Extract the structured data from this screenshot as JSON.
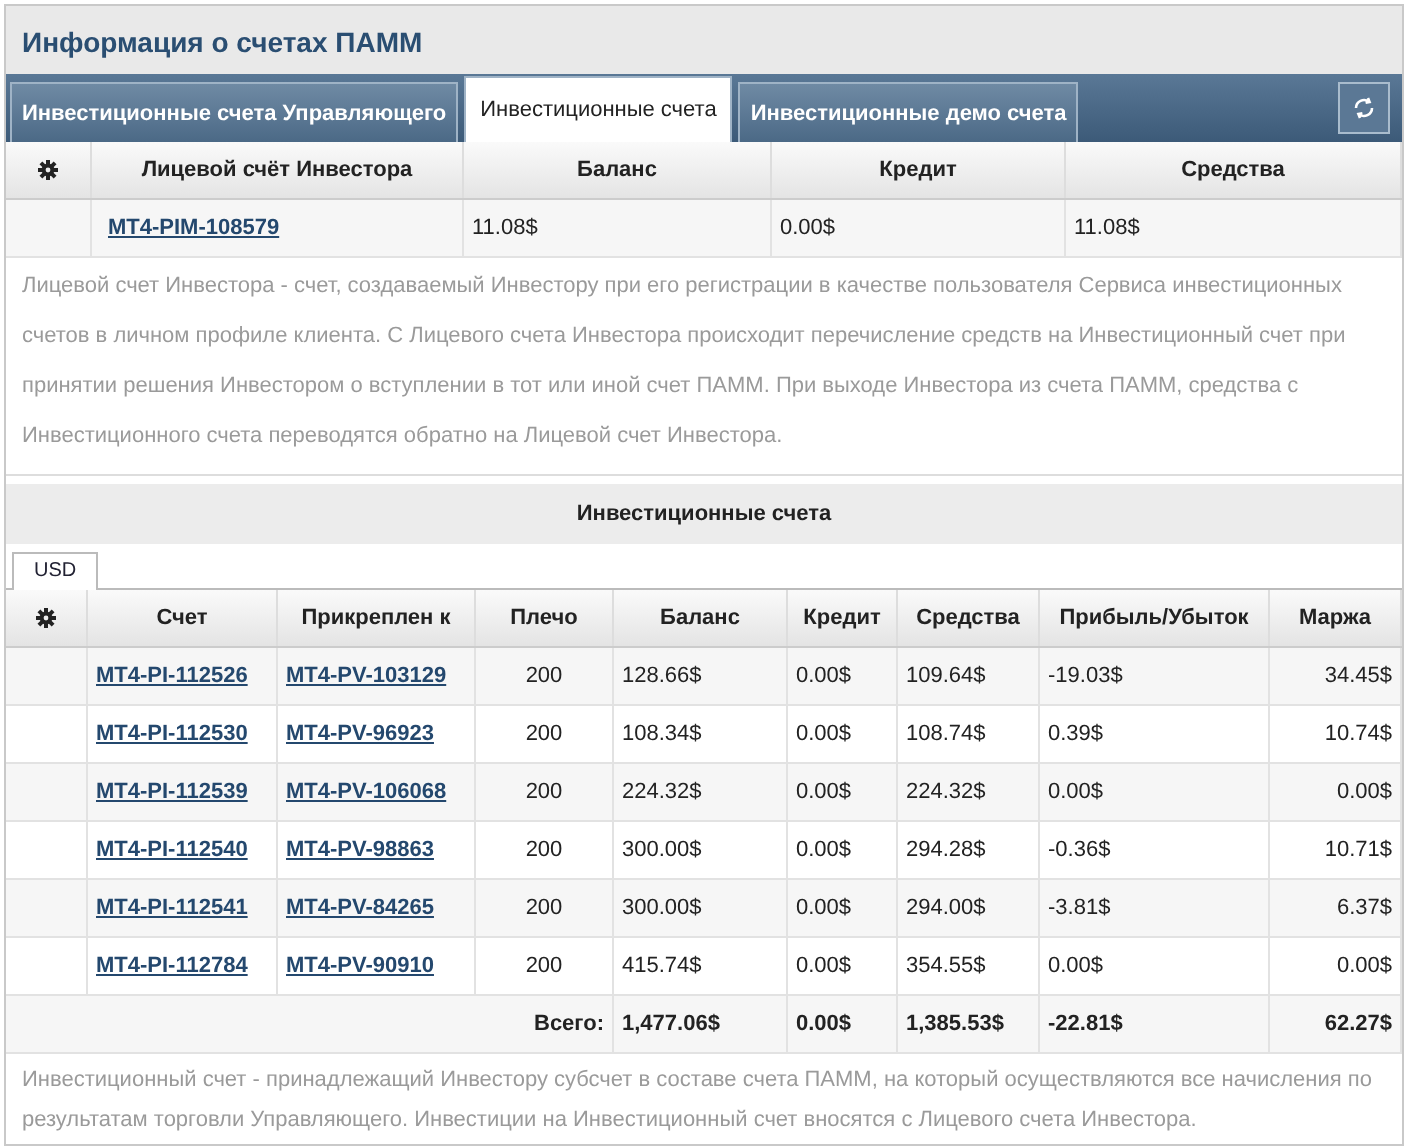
{
  "title": "Информация о счетах ПАММ",
  "tabs": [
    {
      "label": "Инвестиционные счета Управляющего",
      "selected": false
    },
    {
      "label": "Инвестиционные счета",
      "selected": true
    },
    {
      "label": "Инвестиционные демо счета",
      "selected": false
    }
  ],
  "personal_table": {
    "columns": [
      "Лицевой счёт Инвестора",
      "Баланс",
      "Кредит",
      "Средства"
    ],
    "rows": [
      {
        "account": "MT4-PIM-108579",
        "balance": "11.08$",
        "credit": "0.00$",
        "equity": "11.08$"
      }
    ]
  },
  "personal_note": "Лицевой счет Инвестора - счет, создаваемый Инвестору при его регистрации в качестве пользователя Сервиса инвестиционных счетов в личном профиле клиента. С Лицевого счета Инвестора происходит перечисление средств на Инвестиционный счет при принятии решения Инвестором о вступлении в тот или иной счет ПАММ. При выходе Инвестора из счета ПАММ, средства с Инвестиционного счета переводятся обратно на Лицевой счет Инвестора.",
  "section_title": "Инвестиционные счета",
  "currency_tabs": [
    {
      "label": "USD",
      "selected": true
    }
  ],
  "investment_table": {
    "columns": [
      "Счет",
      "Прикреплен к",
      "Плечо",
      "Баланс",
      "Кредит",
      "Средства",
      "Прибыль/Убыток",
      "Маржа"
    ],
    "rows": [
      {
        "account": "MT4-PI-112526",
        "attached": "MT4-PV-103129",
        "leverage": "200",
        "balance": "128.66$",
        "credit": "0.00$",
        "equity": "109.64$",
        "profit": "-19.03$",
        "margin": "34.45$"
      },
      {
        "account": "MT4-PI-112530",
        "attached": "MT4-PV-96923",
        "leverage": "200",
        "balance": "108.34$",
        "credit": "0.00$",
        "equity": "108.74$",
        "profit": "0.39$",
        "margin": "10.74$"
      },
      {
        "account": "MT4-PI-112539",
        "attached": "MT4-PV-106068",
        "leverage": "200",
        "balance": "224.32$",
        "credit": "0.00$",
        "equity": "224.32$",
        "profit": "0.00$",
        "margin": "0.00$"
      },
      {
        "account": "MT4-PI-112540",
        "attached": "MT4-PV-98863",
        "leverage": "200",
        "balance": "300.00$",
        "credit": "0.00$",
        "equity": "294.28$",
        "profit": "-0.36$",
        "margin": "10.71$"
      },
      {
        "account": "MT4-PI-112541",
        "attached": "MT4-PV-84265",
        "leverage": "200",
        "balance": "300.00$",
        "credit": "0.00$",
        "equity": "294.00$",
        "profit": "-3.81$",
        "margin": "6.37$"
      },
      {
        "account": "MT4-PI-112784",
        "attached": "MT4-PV-90910",
        "leverage": "200",
        "balance": "415.74$",
        "credit": "0.00$",
        "equity": "354.55$",
        "profit": "0.00$",
        "margin": "0.00$"
      }
    ],
    "total": {
      "label": "Всего:",
      "balance": "1,477.06$",
      "credit": "0.00$",
      "equity": "1,385.53$",
      "profit": "-22.81$",
      "margin": "62.27$"
    }
  },
  "investment_note": "Инвестиционный счет - принадлежащий Инвестору субсчет в составе счета ПАММ, на который осуществляются все начисления по результатам торговли Управляющего. Инвестиции на Инвестиционный счет вносятся с Лицевого счета Инвестора."
}
